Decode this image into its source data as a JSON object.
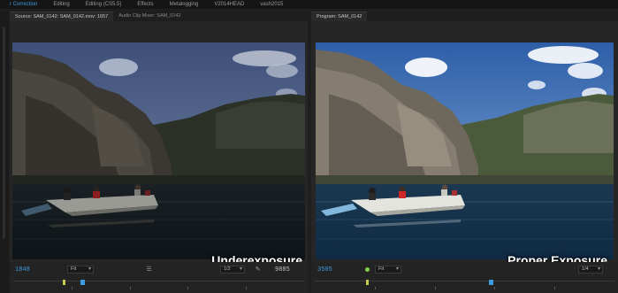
{
  "workspaces": [
    {
      "label": "r Correction",
      "active": true
    },
    {
      "label": "Editing",
      "active": false
    },
    {
      "label": "Editing (CS5.5)",
      "active": false
    },
    {
      "label": "Effects",
      "active": false
    },
    {
      "label": "Metalogging",
      "active": false
    },
    {
      "label": "V2014HEAD",
      "active": false
    },
    {
      "label": "vash2015",
      "active": false
    }
  ],
  "source_panel": {
    "tabs": [
      {
        "label": "Source: SAM_0142: SAM_0142.mov: 1657",
        "active": true
      },
      {
        "label": "Audio Clip Mixer: SAM_0142",
        "active": false
      }
    ],
    "overlay_label": "Underexposure",
    "timecode": "1848",
    "fit": "Fit",
    "resolution": "1/2",
    "duration": "9885",
    "playhead_fraction": 0.23,
    "marker_fraction": 0.17
  },
  "program_panel": {
    "tabs": [
      {
        "label": "Program: SAM_0142",
        "active": true
      }
    ],
    "overlay_label": "Proper Exposure",
    "timecode": "3505",
    "fit": "Fit",
    "resolution": "1/4",
    "playhead_fraction": 0.58,
    "marker_fraction": 0.17
  },
  "colors": {
    "accent": "#3d9be0",
    "panel_bg": "#262626",
    "status_green": "#7fd04a"
  }
}
